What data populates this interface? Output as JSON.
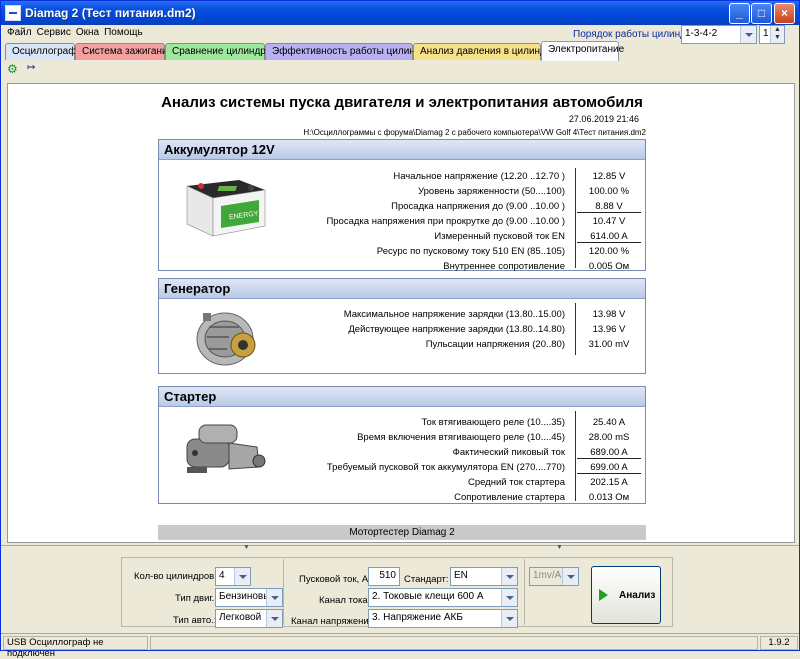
{
  "window": {
    "title": "Diamag 2 (Тест питания.dm2)"
  },
  "menu": [
    "Файл",
    "Сервис",
    "Окна",
    "Помощь"
  ],
  "cylinder_order": {
    "label": "Порядок работы цилиндров",
    "value": "1-3-4-2",
    "spin_value": "1"
  },
  "tabs": [
    {
      "label": "Осциллограф",
      "color": "#d8e6f8"
    },
    {
      "label": "Система зажигания",
      "color": "#f4a0a0"
    },
    {
      "label": "Сравнение цилиндров",
      "color": "#9ee89e"
    },
    {
      "label": "Эффективность работы цилиндров",
      "color": "#b8b0f0"
    },
    {
      "label": "Анализ давления в цилиндре",
      "color": "#f7e08a"
    },
    {
      "label": "Электропитание",
      "color": "#fcfcfe"
    }
  ],
  "report": {
    "title": "Анализ системы пуска двигателя и электропитания автомобиля",
    "date": "27.06.2019 21:46",
    "path": "H:\\Осциллограммы с форума\\Diamag 2 с рабочего компьютера\\VW Golf 4\\Тест питания.dm2",
    "battery": {
      "header": "Аккумулятор 12V",
      "rows": [
        {
          "label": "Начальное напряжение (12.20 ..12.70 )",
          "value": "12.85 V",
          "underline": false
        },
        {
          "label": "Уровень заряженности (50....100)",
          "value": "100.00 %",
          "underline": false
        },
        {
          "label": "Просадка напряжения до (9.00 ..10.00 )",
          "value": "8.88 V",
          "underline": true
        },
        {
          "label": "Просадка напряжения при прокрутке до (9.00 ..10.00 )",
          "value": "10.47 V",
          "underline": false
        },
        {
          "label": "Измеренный пусковой ток  EN",
          "value": "614.00 A",
          "underline": true
        },
        {
          "label": "Ресурс по пусковому току  510 EN (85..105)",
          "value": "120.00 %",
          "underline": false
        },
        {
          "label": "Внутреннее сопротивление",
          "value": "0.005 Ом",
          "underline": false
        }
      ]
    },
    "generator": {
      "header": "Генератор",
      "rows": [
        {
          "label": "Максимальное напряжение зарядки  (13.80..15.00)",
          "value": "13.98 V",
          "underline": false
        },
        {
          "label": "Действующее напряжение зарядки (13.80..14.80)",
          "value": "13.96 V",
          "underline": false
        },
        {
          "label": "Пульсации напряжения (20..80)",
          "value": "31.00 mV",
          "underline": false
        }
      ]
    },
    "starter": {
      "header": "Стартер",
      "rows": [
        {
          "label": "Ток втягивающего реле (10....35)",
          "value": "25.40 A",
          "underline": false
        },
        {
          "label": "Время включения втягивающего реле (10....45)",
          "value": "28.00 mS",
          "underline": false
        },
        {
          "label": "Фактический пиковый ток",
          "value": "689.00 A",
          "underline": true
        },
        {
          "label": "Требуемый пусковой ток аккумулятора  EN (270....770)",
          "value": "699.00 A",
          "underline": true
        },
        {
          "label": "Средний ток стартера",
          "value": "202.15 A",
          "underline": false
        },
        {
          "label": "Сопротивление стартера",
          "value": "0.013 Ом",
          "underline": false
        }
      ]
    },
    "footer": "Мотортестер Diamag 2"
  },
  "controls": {
    "cyl_count_label": "Кол-во цилиндров:",
    "cyl_count_value": "4",
    "engine_type_label": "Тип двиг.:",
    "engine_type_value": "Бензиновый",
    "car_type_label": "Тип авто.:",
    "car_type_value": "Легковой",
    "start_current_label": "Пусковой ток, А:",
    "start_current_value": "510",
    "standard_label": "Стандарт:",
    "standard_value": "EN",
    "current_channel_label": "Канал тока:",
    "current_channel_value": "2. Токовые клещи 600 А",
    "voltage_channel_label": "Канал напряжения:",
    "voltage_channel_value": "3. Напряжение АКБ",
    "scale_value": "1mv/A",
    "analyze_label": "Анализ"
  },
  "status": {
    "left": "USB Осциллограф не подключен",
    "version": "1.9.2"
  }
}
